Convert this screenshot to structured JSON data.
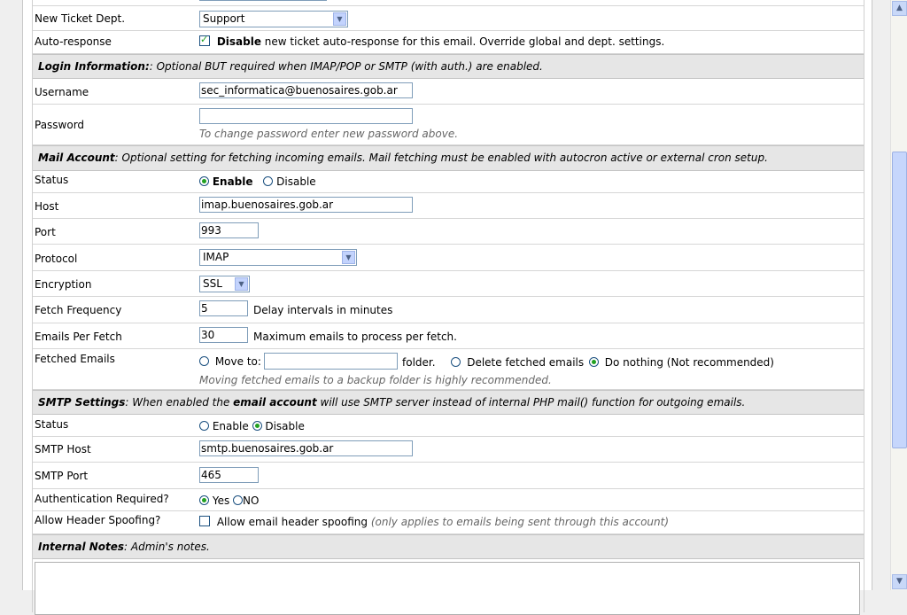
{
  "form": {
    "new_ticket_dept": {
      "label": "New Ticket Dept.",
      "selected": "Support"
    },
    "auto_response": {
      "label": "Auto-response",
      "checkbox_bold": "Disable",
      "checkbox_text": " new ticket auto-response for this email. Override global and dept. settings."
    },
    "login_header": {
      "title": "Login Information:",
      "text": ": Optional BUT required when IMAP/POP or SMTP (with auth.) are enabled."
    },
    "username": {
      "label": "Username",
      "value": "sec_informatica@buenosaires.gob.ar"
    },
    "password": {
      "label": "Password",
      "value": "",
      "note": "To change password enter new password above."
    },
    "mail_header": {
      "title": "Mail Account",
      "text": ": Optional setting for fetching incoming emails. Mail fetching must be enabled with autocron active or external cron setup."
    },
    "status": {
      "label": "Status",
      "enable": "Enable",
      "disable": "Disable"
    },
    "host": {
      "label": "Host",
      "value": "imap.buenosaires.gob.ar"
    },
    "port": {
      "label": "Port",
      "value": "993"
    },
    "protocol": {
      "label": "Protocol",
      "selected": "IMAP"
    },
    "encryption": {
      "label": "Encryption",
      "selected": "SSL"
    },
    "fetch_frequency": {
      "label": "Fetch Frequency",
      "value": "5",
      "suffix": "Delay intervals in minutes"
    },
    "emails_per_fetch": {
      "label": "Emails Per Fetch",
      "value": "30",
      "suffix": "Maximum emails to process per fetch."
    },
    "fetched_emails": {
      "label": "Fetched Emails",
      "move_to": "Move to:",
      "folder_value": "",
      "folder_suffix": "folder.",
      "delete": "Delete fetched emails",
      "do_nothing": "Do nothing (Not recommended)",
      "note": "Moving fetched emails to a backup folder is highly recommended."
    },
    "smtp_header": {
      "title": "SMTP Settings",
      "text1": ": When enabled the ",
      "bold2": "email account",
      "text2": " will use SMTP server instead of internal PHP mail() function for outgoing emails."
    },
    "smtp_status": {
      "label": "Status",
      "enable": "Enable",
      "disable": "Disable"
    },
    "smtp_host": {
      "label": "SMTP Host",
      "value": "smtp.buenosaires.gob.ar"
    },
    "smtp_port": {
      "label": "SMTP Port",
      "value": "465"
    },
    "auth_required": {
      "label": "Authentication Required?",
      "yes": "Yes",
      "no": "NO"
    },
    "header_spoofing": {
      "label": "Allow Header Spoofing?",
      "checkbox_text": "Allow email header spoofing",
      "note": "(only applies to emails being sent through this account)"
    },
    "notes_header": {
      "title": "Internal Notes",
      "text": ": Admin's notes."
    }
  }
}
